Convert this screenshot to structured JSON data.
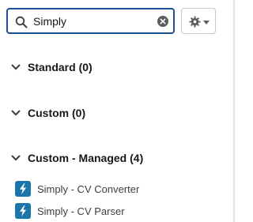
{
  "search": {
    "value": "Simply",
    "placeholder": ""
  },
  "sections": [
    {
      "label": "Standard (0)"
    },
    {
      "label": "Custom (0)"
    },
    {
      "label": "Custom - Managed (4)"
    }
  ],
  "items": [
    {
      "label": "Simply - CV Converter",
      "icon": "lightning-bolt-icon"
    },
    {
      "label": "Simply - CV Parser",
      "icon": "lightning-bolt-icon"
    }
  ],
  "colors": {
    "search_border": "#1b5297",
    "section_text": "#181818",
    "item_text": "#3e3e3c",
    "badge": "#1b75a8"
  }
}
